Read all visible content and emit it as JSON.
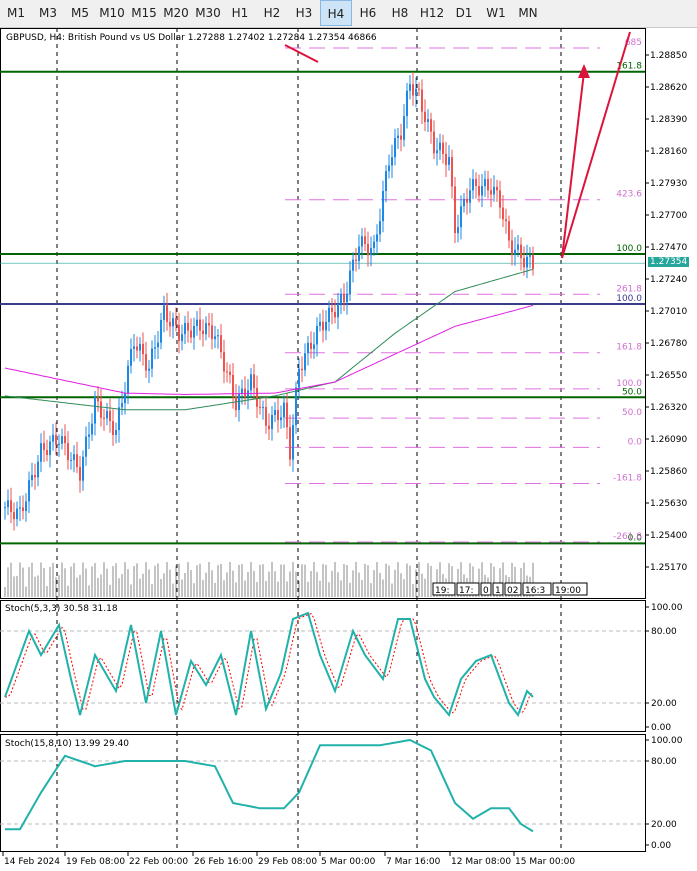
{
  "toolbar": {
    "timeframes": [
      "M1",
      "M3",
      "M5",
      "M10",
      "M15",
      "M20",
      "M30",
      "H1",
      "H2",
      "H3",
      "H4",
      "H6",
      "H8",
      "H12",
      "D1",
      "W1",
      "MN"
    ],
    "active": "H4"
  },
  "header": {
    "info": "GBPUSD, H4:  British Pound vs US Dollar  1.27288 1.27402 1.27284 1.27354  46866"
  },
  "current_price": "1.27354",
  "stoch1": {
    "label": "Stoch(5,3,3) 30.58 31.18"
  },
  "stoch2": {
    "label": "Stoch(15,8,10) 13.99 29.40"
  },
  "colors": {
    "bull": "#1e88e5",
    "bear": "#ef5350",
    "accent": "#26a69a",
    "fib": "#e070e0",
    "level": "#006400"
  },
  "chart_data": {
    "type": "candlestick",
    "symbol": "GBPUSD",
    "timeframe": "H4",
    "price_axis": [
      "1.28850",
      "1.28620",
      "1.28390",
      "1.28160",
      "1.27930",
      "1.27700",
      "1.27470",
      "1.27240",
      "1.27010",
      "1.26780",
      "1.26550",
      "1.26320",
      "1.26090",
      "1.25860",
      "1.25630",
      "1.25400",
      "1.25170"
    ],
    "ylim": [
      1.2501,
      1.2905
    ],
    "date_axis": [
      "14 Feb 2024",
      "19 Feb 08:00",
      "22 Feb 00:00",
      "26 Feb 16:00",
      "29 Feb 08:00",
      "5 Mar 00:00",
      "7 Mar 16:00",
      "12 Mar 08:00",
      "15 Mar 00:00"
    ],
    "close_anchors": [
      [
        0,
        1.256
      ],
      [
        5,
        1.2555
      ],
      [
        12,
        1.26
      ],
      [
        18,
        1.261
      ],
      [
        25,
        1.2585
      ],
      [
        30,
        1.2635
      ],
      [
        37,
        1.2615
      ],
      [
        43,
        1.268
      ],
      [
        48,
        1.266
      ],
      [
        53,
        1.27
      ],
      [
        58,
        1.2685
      ],
      [
        65,
        1.269
      ],
      [
        70,
        1.2685
      ],
      [
        77,
        1.2635
      ],
      [
        82,
        1.265
      ],
      [
        87,
        1.262
      ],
      [
        93,
        1.263
      ],
      [
        95,
        1.26
      ],
      [
        98,
        1.266
      ],
      [
        105,
        1.269
      ],
      [
        113,
        1.271
      ],
      [
        118,
        1.275
      ],
      [
        123,
        1.2745
      ],
      [
        128,
        1.281
      ],
      [
        132,
        1.283
      ],
      [
        135,
        1.2865
      ],
      [
        138,
        1.2855
      ],
      [
        143,
        1.282
      ],
      [
        148,
        1.281
      ],
      [
        150,
        1.276
      ],
      [
        155,
        1.279
      ],
      [
        162,
        1.279
      ],
      [
        165,
        1.278
      ],
      [
        168,
        1.275
      ],
      [
        173,
        1.2738
      ],
      [
        176,
        1.27354
      ]
    ],
    "ma_green": [
      [
        0,
        1.264
      ],
      [
        40,
        1.263
      ],
      [
        60,
        1.263
      ],
      [
        90,
        1.264
      ],
      [
        110,
        1.265
      ],
      [
        130,
        1.2685
      ],
      [
        150,
        1.2715
      ],
      [
        176,
        1.2731
      ]
    ],
    "ma_magenta": [
      [
        0,
        1.266
      ],
      [
        40,
        1.2642
      ],
      [
        60,
        1.2641
      ],
      [
        90,
        1.2642
      ],
      [
        110,
        1.265
      ],
      [
        130,
        1.267
      ],
      [
        150,
        1.269
      ],
      [
        176,
        1.2705
      ]
    ],
    "fib_levels": [
      {
        "label": "685",
        "price": 1.289
      },
      {
        "label": "423.6",
        "price": 1.2781
      },
      {
        "label": "261.8",
        "price": 1.2713
      },
      {
        "label": "161.8",
        "price": 1.2671
      },
      {
        "label": "100.0",
        "price": 1.2645
      },
      {
        "label": "50.0",
        "price": 1.2624
      },
      {
        "label": "0.0",
        "price": 1.2603
      },
      {
        "label": "-161.8",
        "price": 1.2577
      },
      {
        "label": "-261.8",
        "price": 1.2535
      }
    ],
    "level_lines": [
      {
        "label": "161.8",
        "price": 1.2873
      },
      {
        "label": "100.0",
        "price": 1.2742
      },
      {
        "label": "50.0",
        "price": 1.2639
      },
      {
        "label": "0.0",
        "price": 1.2534
      }
    ],
    "blue_line": {
      "label": "100.0",
      "price": 1.2706
    },
    "stoch_axis": [
      "100.00",
      "80.00",
      "20.00",
      "0.00"
    ],
    "stoch1_main": [
      [
        0,
        25
      ],
      [
        8,
        80
      ],
      [
        12,
        60
      ],
      [
        18,
        85
      ],
      [
        22,
        40
      ],
      [
        25,
        10
      ],
      [
        30,
        60
      ],
      [
        37,
        30
      ],
      [
        42,
        85
      ],
      [
        47,
        20
      ],
      [
        52,
        80
      ],
      [
        57,
        10
      ],
      [
        62,
        55
      ],
      [
        67,
        35
      ],
      [
        72,
        60
      ],
      [
        77,
        10
      ],
      [
        82,
        80
      ],
      [
        87,
        15
      ],
      [
        92,
        45
      ],
      [
        96,
        90
      ],
      [
        101,
        95
      ],
      [
        105,
        60
      ],
      [
        110,
        30
      ],
      [
        116,
        80
      ],
      [
        120,
        60
      ],
      [
        126,
        40
      ],
      [
        131,
        90
      ],
      [
        135,
        90
      ],
      [
        140,
        40
      ],
      [
        143,
        25
      ],
      [
        148,
        10
      ],
      [
        152,
        40
      ],
      [
        157,
        55
      ],
      [
        162,
        60
      ],
      [
        165,
        40
      ],
      [
        168,
        20
      ],
      [
        171,
        10
      ],
      [
        174,
        30
      ],
      [
        176,
        25
      ]
    ],
    "stoch2_main": [
      [
        0,
        15
      ],
      [
        5,
        15
      ],
      [
        12,
        50
      ],
      [
        20,
        85
      ],
      [
        30,
        75
      ],
      [
        40,
        80
      ],
      [
        50,
        80
      ],
      [
        60,
        80
      ],
      [
        70,
        75
      ],
      [
        76,
        40
      ],
      [
        85,
        35
      ],
      [
        93,
        35
      ],
      [
        98,
        50
      ],
      [
        105,
        95
      ],
      [
        115,
        95
      ],
      [
        125,
        95
      ],
      [
        135,
        100
      ],
      [
        142,
        90
      ],
      [
        150,
        40
      ],
      [
        156,
        25
      ],
      [
        162,
        35
      ],
      [
        168,
        35
      ],
      [
        172,
        20
      ],
      [
        176,
        13
      ]
    ],
    "timebox_labels": [
      "19:",
      "17:",
      "0",
      "1",
      "02",
      "16:3",
      "19:00"
    ]
  }
}
